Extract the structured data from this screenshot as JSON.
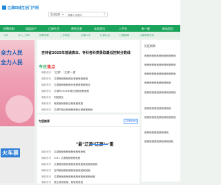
{
  "site": {
    "logo_text": "辽源四线生活门户网"
  },
  "search": {
    "scope": "生活信息",
    "placeholder": "请输入关键字"
  },
  "nav": {
    "items": [
      "招聘求职",
      "楼盘房产",
      "辽源生活",
      "便民信息",
      "本地资讯",
      "二手车",
      "新一屋",
      "网站首页"
    ]
  },
  "subnav": {
    "items": [
      "今天",
      "今入二手车",
      "招聘求职",
      "二手物品",
      "辽源人才",
      "辽源生活",
      "辽源新闻",
      "辽源商家资讯"
    ]
  },
  "banner": {
    "line1": "全力人民",
    "line2": "全力人民"
  },
  "main": {
    "headline": "吉林省2025年普通高本、专科各科类录取最低控制分数线",
    "section_title_prefix": "今日",
    "section_title_accent": "焦点",
    "items": [
      {
        "date": "最新资讯",
        "title": "\"辽源\"、\"辽源\"一重"
      },
      {
        "date": "最新资讯",
        "title": "辽源就就就就就业就就就就就就"
      },
      {
        "date": "最新资讯",
        "title": "辽源就就就就就业就就就就就就业"
      },
      {
        "date": "最新资讯",
        "title": "辽源市2025年就业就就就就就就"
      },
      {
        "date": "最新资讯",
        "title": "别就就业"
      },
      {
        "date": "最新资讯",
        "title": "就就就就就就业就就就就就"
      },
      {
        "date": "最新资讯",
        "title": "辽源市就业就就就就就业就就就就就"
      }
    ]
  },
  "recommend": {
    "title": "为您推荐",
    "more_label": "辽源更多新闻",
    "featured_title": "\"最\"辽源\"辽源\"一重",
    "items": [
      {
        "date": "最新资讯",
        "title": "辽源就就就就就就就就就就就"
      },
      {
        "date": "最新资讯",
        "title": "2011 辽源就就就就就就"
      },
      {
        "date": "最新资讯",
        "title": "辽源就就就就就就就就就就就就就就就就"
      },
      {
        "date": "最新资讯",
        "title": "吉林就就就就就就就就就就就就就"
      },
      {
        "date": "最新资讯",
        "title": "辽源就就就就就就就就就就就就就就就"
      },
      {
        "date": "最新资讯",
        "title": "就业就就就就、就就就就就"
      }
    ]
  },
  "sidebar": {
    "title": "社区新闻",
    "items": [
      "就就就就就就就就就就就就就",
      "就就就就就就就就就就就就就",
      "就就就就就就就就就就就就就",
      "就就就就就就就就就就就",
      "就就就就就就就就就就就就就",
      "就就就就就就就就就就就",
      "就就就就就就就就就就就就就",
      "就就就就就就就就就就",
      "就就就就就就就就就就就就"
    ]
  },
  "bottom_banner": {
    "text": "火车票"
  }
}
